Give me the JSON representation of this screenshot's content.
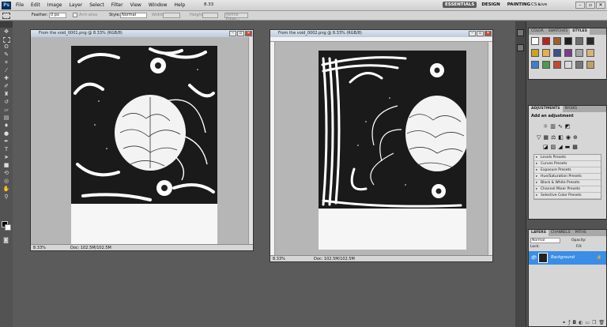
{
  "menubar": {
    "app_icon": "Ps",
    "menus": [
      "File",
      "Edit",
      "Image",
      "Layer",
      "Select",
      "Filter",
      "View",
      "Window",
      "Help"
    ],
    "zoom_text": "8.33",
    "workspaces": [
      "ESSENTIALS",
      "DESIGN",
      "PAINTING"
    ],
    "workspace_more": "»",
    "cs_live": "CS Live",
    "window_controls": [
      "–",
      "▫",
      "✕"
    ]
  },
  "options": {
    "feather_label": "Feather:",
    "feather_value": "0 px",
    "antialias_label": "Anti-alias",
    "style_label": "Style:",
    "style_value": "Normal",
    "width_label": "Width:",
    "height_label": "Height:",
    "refine_label": "Refine Edge..."
  },
  "tools": [
    "move",
    "marquee",
    "lasso",
    "quick-select",
    "crop",
    "eyedropper",
    "healing",
    "brush",
    "stamp",
    "history-brush",
    "eraser",
    "gradient",
    "blur",
    "dodge",
    "pen",
    "type",
    "path-select",
    "shape",
    "3d-rotate",
    "3d-orbit",
    "hand",
    "zoom"
  ],
  "doc1": {
    "title": "From the void_0001.png @ 8.33% (RGB/8)",
    "zoom": "8.33%",
    "doc_info": "Doc: 102.5M/102.5M"
  },
  "doc2": {
    "title": "From the void_0002.png @ 8.33% (RGB/8)",
    "zoom": "8.33%",
    "doc_info": "Doc: 102.5M/102.5M"
  },
  "panel_color": {
    "tabs": [
      "COLOR",
      "SWATCHES",
      "STYLES"
    ],
    "active_tab": "STYLES",
    "swatches": [
      "#ffffff",
      "#b3261e",
      "#9c5f2b",
      "#1f1f1f",
      "#6d6d6d",
      "#2a2a2a",
      "#c9a227",
      "#e6b04a",
      "#3a4f8c",
      "#7a3b8c",
      "#a5a5a5",
      "#d9b27c",
      "#3f7ec9",
      "#4f9a4a",
      "#c44a2f",
      "#d8d8d8",
      "#777777",
      "#bfa06a"
    ]
  },
  "panel_adjust": {
    "tabs": [
      "ADJUSTMENTS",
      "MASKS"
    ],
    "heading": "Add an adjustment",
    "presets": [
      "Levels Presets",
      "Curves Presets",
      "Exposure Presets",
      "Hue/Saturation Presets",
      "Black & White Presets",
      "Channel Mixer Presets",
      "Selective Color Presets"
    ]
  },
  "panel_layers": {
    "tabs": [
      "LAYERS",
      "CHANNELS",
      "PATHS"
    ],
    "blend_mode": "Normal",
    "opacity_label": "Opacity:",
    "lock_label": "Lock:",
    "fill_label": "Fill:",
    "layer_name": "Background"
  }
}
